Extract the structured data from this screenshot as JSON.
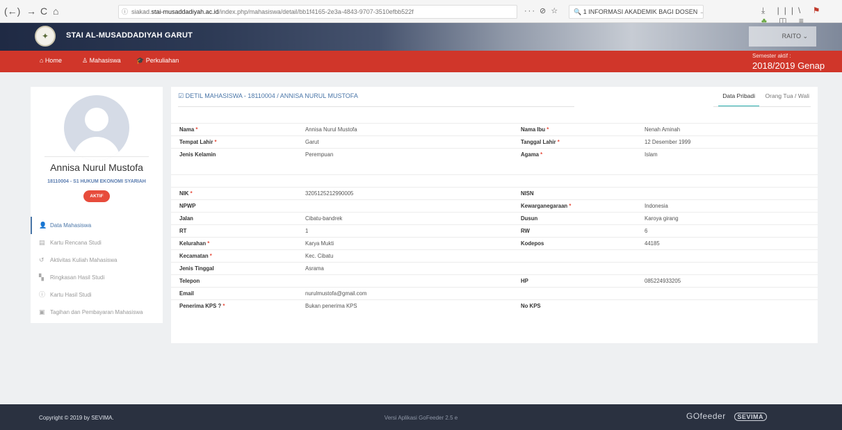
{
  "browser": {
    "back": "(←)",
    "forward": "→",
    "reload": "C",
    "home": "⌂",
    "url_info_icon": "ⓘ",
    "url_prefix": "siakad.",
    "url_domain": "stai-musaddadiyah.ac.id",
    "url_path": "/index.php/mahasiswa/detail/bb1f4165-2e3a-4843-9707-3510efbb522f",
    "page_actions": "··· ⊘ ☆",
    "search_text": "🔍 1 INFORMASI AKADEMIK BAGI DOSEN →",
    "toolbar_download": "⤓",
    "toolbar_library": "|||\\",
    "toolbar_flag": "⚑",
    "toolbar_ext": "♣",
    "toolbar_sidebar": "◫",
    "toolbar_menu": "≡"
  },
  "app": {
    "title": "STAI AL-MUSADDADIYAH GARUT",
    "user": "RAITO ⌄"
  },
  "nav": {
    "home": "⌂ Home",
    "mahasiswa": "♙ Mahasiswa",
    "perkuliahan": "🎓 Perkuliahan",
    "semester_label": "Semester aktif :",
    "semester_value": "2018/2019 Genap"
  },
  "profile": {
    "name": "Annisa Nurul Mustofa",
    "id": "18110004 - S1 HUKUM EKONOMI SYARIAH",
    "status": "AKTIF",
    "menu": [
      {
        "label": "Data Mahasiswa",
        "icon": "👤"
      },
      {
        "label": "Kartu Rencana Studi",
        "icon": "▤"
      },
      {
        "label": "Aktivitas Kuliah Mahasiswa",
        "icon": "↺"
      },
      {
        "label": "Ringkasan Hasil Studi",
        "icon": "▚"
      },
      {
        "label": "Kartu Hasil Studi",
        "icon": "ⓘ"
      },
      {
        "label": "Tagihan dan Pembayaran Mahasiswa",
        "icon": "▣"
      }
    ]
  },
  "detail": {
    "title": "☑ DETIL MAHASISWA - 18110004 / ANNISA NURUL MUSTOFA",
    "tabs": [
      "Data Pribadi",
      "Orang Tua / Wali"
    ],
    "rows": [
      {
        "l1": "Nama",
        "r1": true,
        "v1": "Annisa Nurul Mustofa",
        "l2": "Nama Ibu",
        "r2": true,
        "v2": "Nenah Aminah"
      },
      {
        "l1": "Tempat Lahir",
        "r1": true,
        "v1": "Garut",
        "l2": "Tanggal Lahir",
        "r2": true,
        "v2": "12 Desember 1999"
      },
      {
        "l1": "Jenis Kelamin",
        "r1": false,
        "v1": "Perempuan",
        "l2": "Agama",
        "r2": true,
        "v2": "Islam",
        "tall": true
      },
      {
        "l1": "",
        "r1": false,
        "v1": "",
        "l2": "",
        "r2": false,
        "v2": ""
      },
      {
        "l1": "NIK",
        "r1": true,
        "v1": "3205125212990005",
        "l2": "NISN",
        "r2": false,
        "v2": ""
      },
      {
        "l1": "NPWP",
        "r1": false,
        "v1": "",
        "l2": "Kewarganegaraan",
        "r2": true,
        "v2": "Indonesia"
      },
      {
        "l1": "Jalan",
        "r1": false,
        "v1": "Cibatu-bandrek",
        "l2": "Dusun",
        "r2": false,
        "v2": "Karoya girang"
      },
      {
        "l1": "RT",
        "r1": false,
        "v1": "1",
        "l2": "RW",
        "r2": false,
        "v2": "6"
      },
      {
        "l1": "Kelurahan",
        "r1": true,
        "v1": "Karya Mukti",
        "l2": "Kodepos",
        "r2": false,
        "v2": "44185"
      },
      {
        "l1": "Kecamatan",
        "r1": true,
        "v1": "Kec. Cibatu",
        "l2": "",
        "r2": false,
        "v2": ""
      },
      {
        "l1": "Jenis Tinggal",
        "r1": false,
        "v1": "Asrama",
        "l2": "",
        "r2": false,
        "v2": ""
      },
      {
        "l1": "Telepon",
        "r1": false,
        "v1": "",
        "l2": "HP",
        "r2": false,
        "v2": "085224933205"
      },
      {
        "l1": "Email",
        "r1": false,
        "v1": "nurulmustofa@gmail.com",
        "l2": "",
        "r2": false,
        "v2": ""
      },
      {
        "l1": "Penerima KPS ?",
        "r1": true,
        "v1": "Bukan penerima KPS",
        "l2": "No KPS",
        "r2": false,
        "v2": ""
      }
    ]
  },
  "footer": {
    "copyright": "Copyright © 2019 by SEVIMA.",
    "version": "Versi Aplikasi GoFeeder 2.5 e",
    "gofeeder": "GOfeeder",
    "sevima": "SEVIMA"
  },
  "colors": {
    "nav_red": "#d0362a",
    "accent_blue": "#4a76a8",
    "badge_red": "#e74c3c",
    "tab_teal": "#2ab0b0",
    "footer_dark": "#2a3140"
  }
}
